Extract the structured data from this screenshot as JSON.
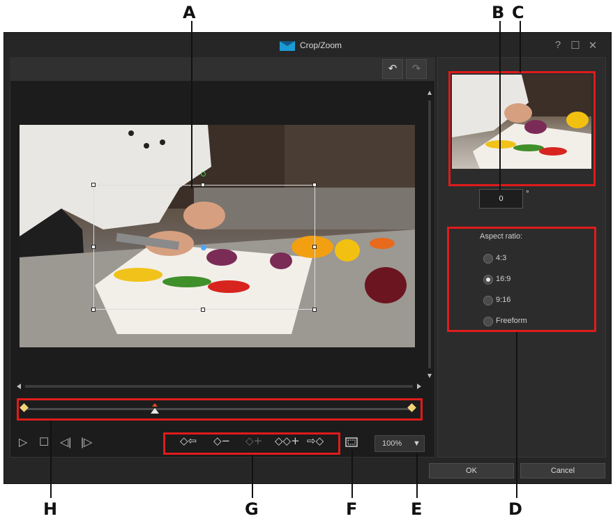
{
  "window": {
    "title": "Crop/Zoom",
    "help": "?",
    "maximize": "☐",
    "close": "✕"
  },
  "toolbar": {
    "undo": "↶",
    "redo": "↷"
  },
  "playback": {
    "play": "▷",
    "stop": "☐",
    "prev_frame": "◁|",
    "next_frame": "|▷"
  },
  "keyframes": {
    "prev": "◇⇦",
    "remove": "◇−",
    "add_disabled": "◇+",
    "duplicate": "◇◇+",
    "next": "⇨◇"
  },
  "zoom": {
    "value": "100%",
    "arrow": "▼"
  },
  "rotation": {
    "value": "0",
    "unit": "°"
  },
  "aspect": {
    "label": "Aspect ratio:",
    "options": [
      "4:3",
      "16:9",
      "9:16",
      "Freeform"
    ],
    "selected": "16:9"
  },
  "buttons": {
    "ok": "OK",
    "cancel": "Cancel"
  },
  "callouts": {
    "A": "A",
    "B": "B",
    "C": "C",
    "D": "D",
    "E": "E",
    "F": "F",
    "G": "G",
    "H": "H"
  },
  "colors": {
    "highlight": "#e01b1b",
    "keyframe": "#f3d37a",
    "background": "#262626"
  }
}
